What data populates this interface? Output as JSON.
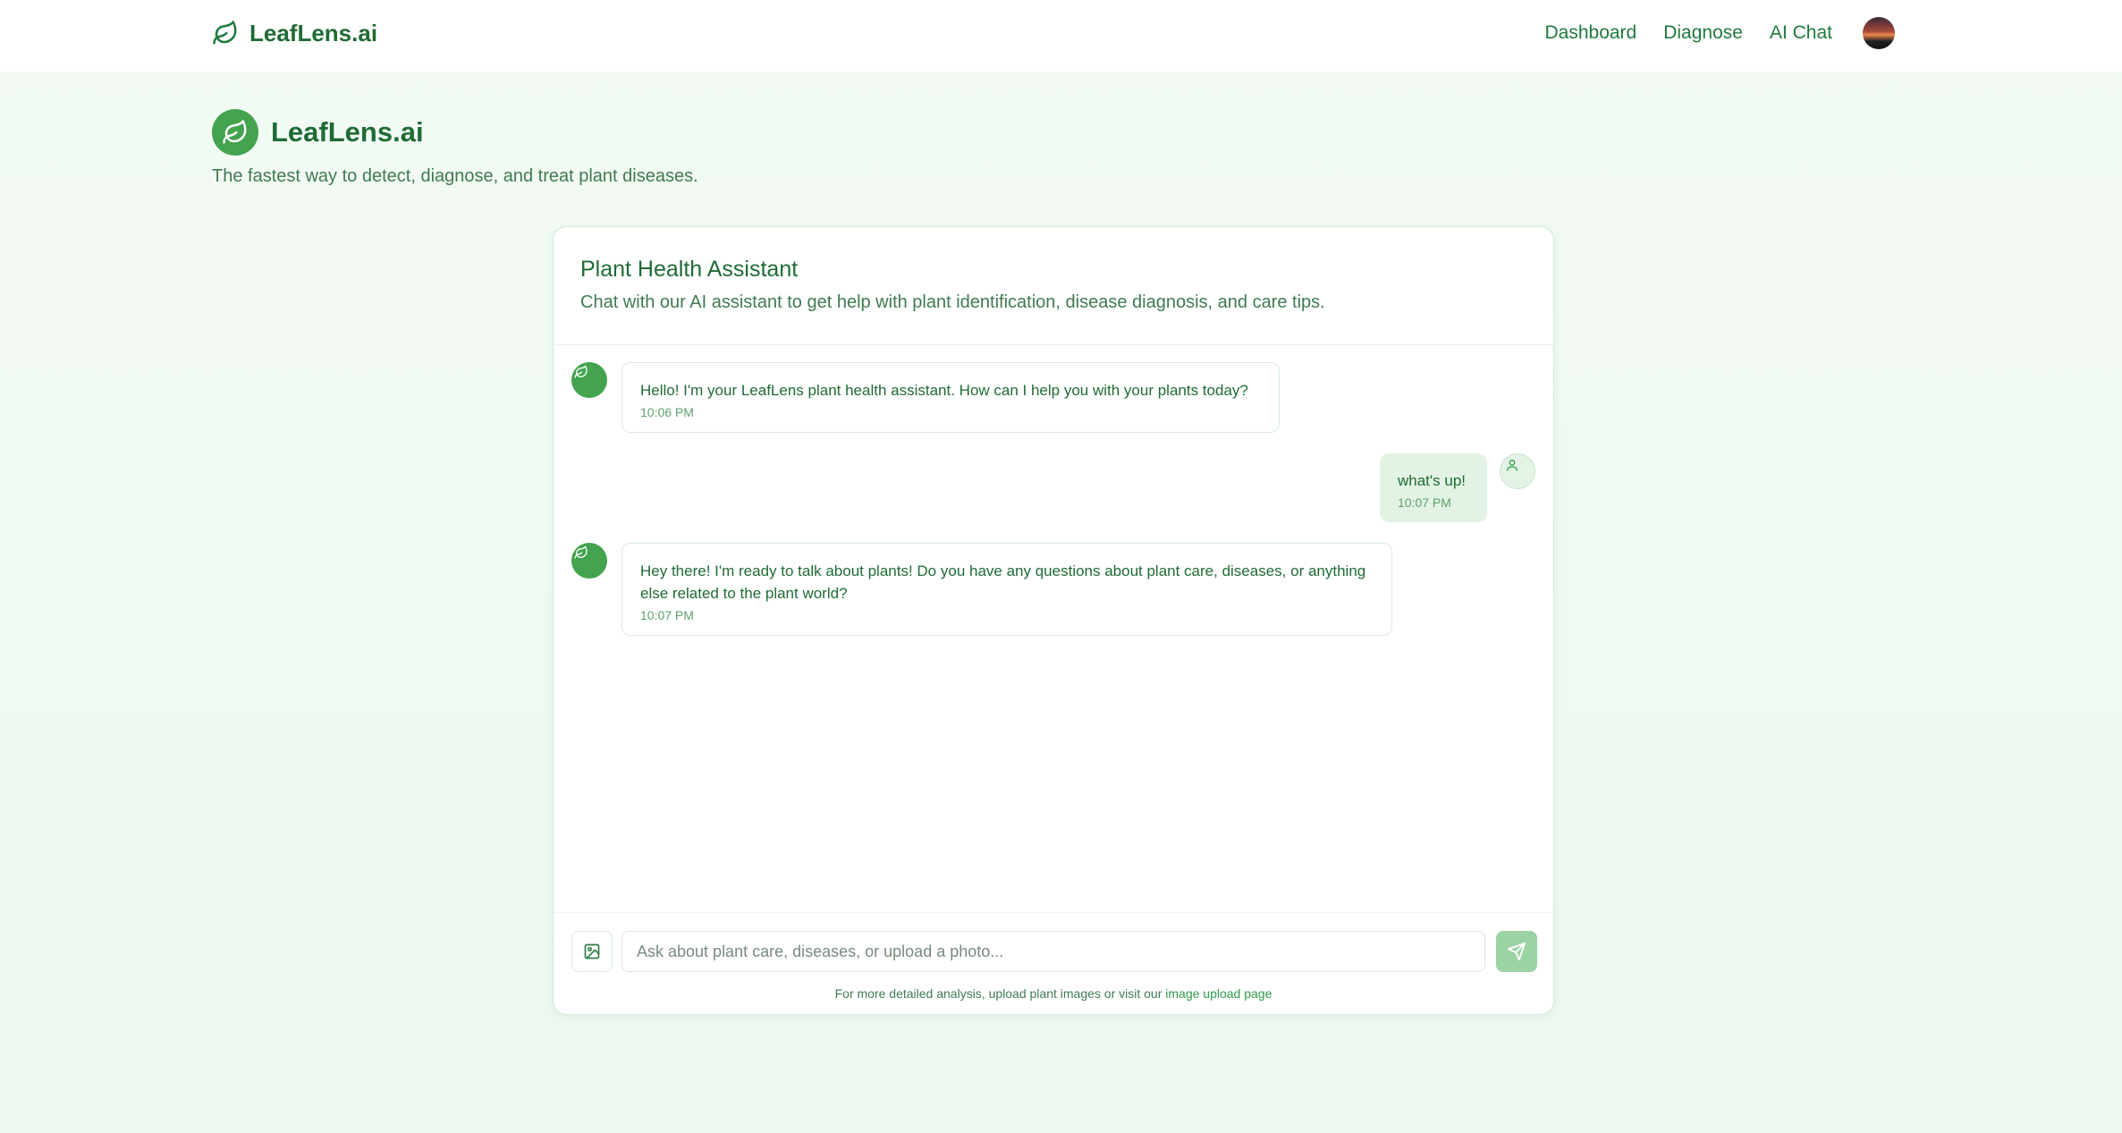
{
  "nav": {
    "brand": "LeafLens.ai",
    "links": [
      "Dashboard",
      "Diagnose",
      "AI Chat"
    ]
  },
  "hero": {
    "title": "LeafLens.ai",
    "subtitle": "The fastest way to detect, diagnose, and treat plant diseases."
  },
  "chat": {
    "title": "Plant Health Assistant",
    "description": "Chat with our AI assistant to get help with plant identification, disease diagnosis, and care tips.",
    "messages": [
      {
        "role": "assistant",
        "text": "Hello! I'm your LeafLens plant health assistant. How can I help you with your plants today?",
        "time": "10:06 PM"
      },
      {
        "role": "user",
        "text": "what's up!",
        "time": "10:07 PM"
      },
      {
        "role": "assistant",
        "text": "Hey there! I'm ready to talk about plants! Do you have any questions about plant care, diseases, or anything else related to the plant world?",
        "time": "10:07 PM"
      }
    ],
    "input_placeholder": "Ask about plant care, diseases, or upload a photo...",
    "input_value": "",
    "footnote_prefix": "For more detailed analysis, upload plant images or visit our ",
    "footnote_link": "image upload page"
  },
  "colors": {
    "brand_green": "#1f6b35",
    "accent_green": "#43a34f",
    "send_disabled": "#9bd3a5"
  },
  "icons": [
    "leaf-icon",
    "user-icon",
    "image-icon",
    "send-icon"
  ]
}
